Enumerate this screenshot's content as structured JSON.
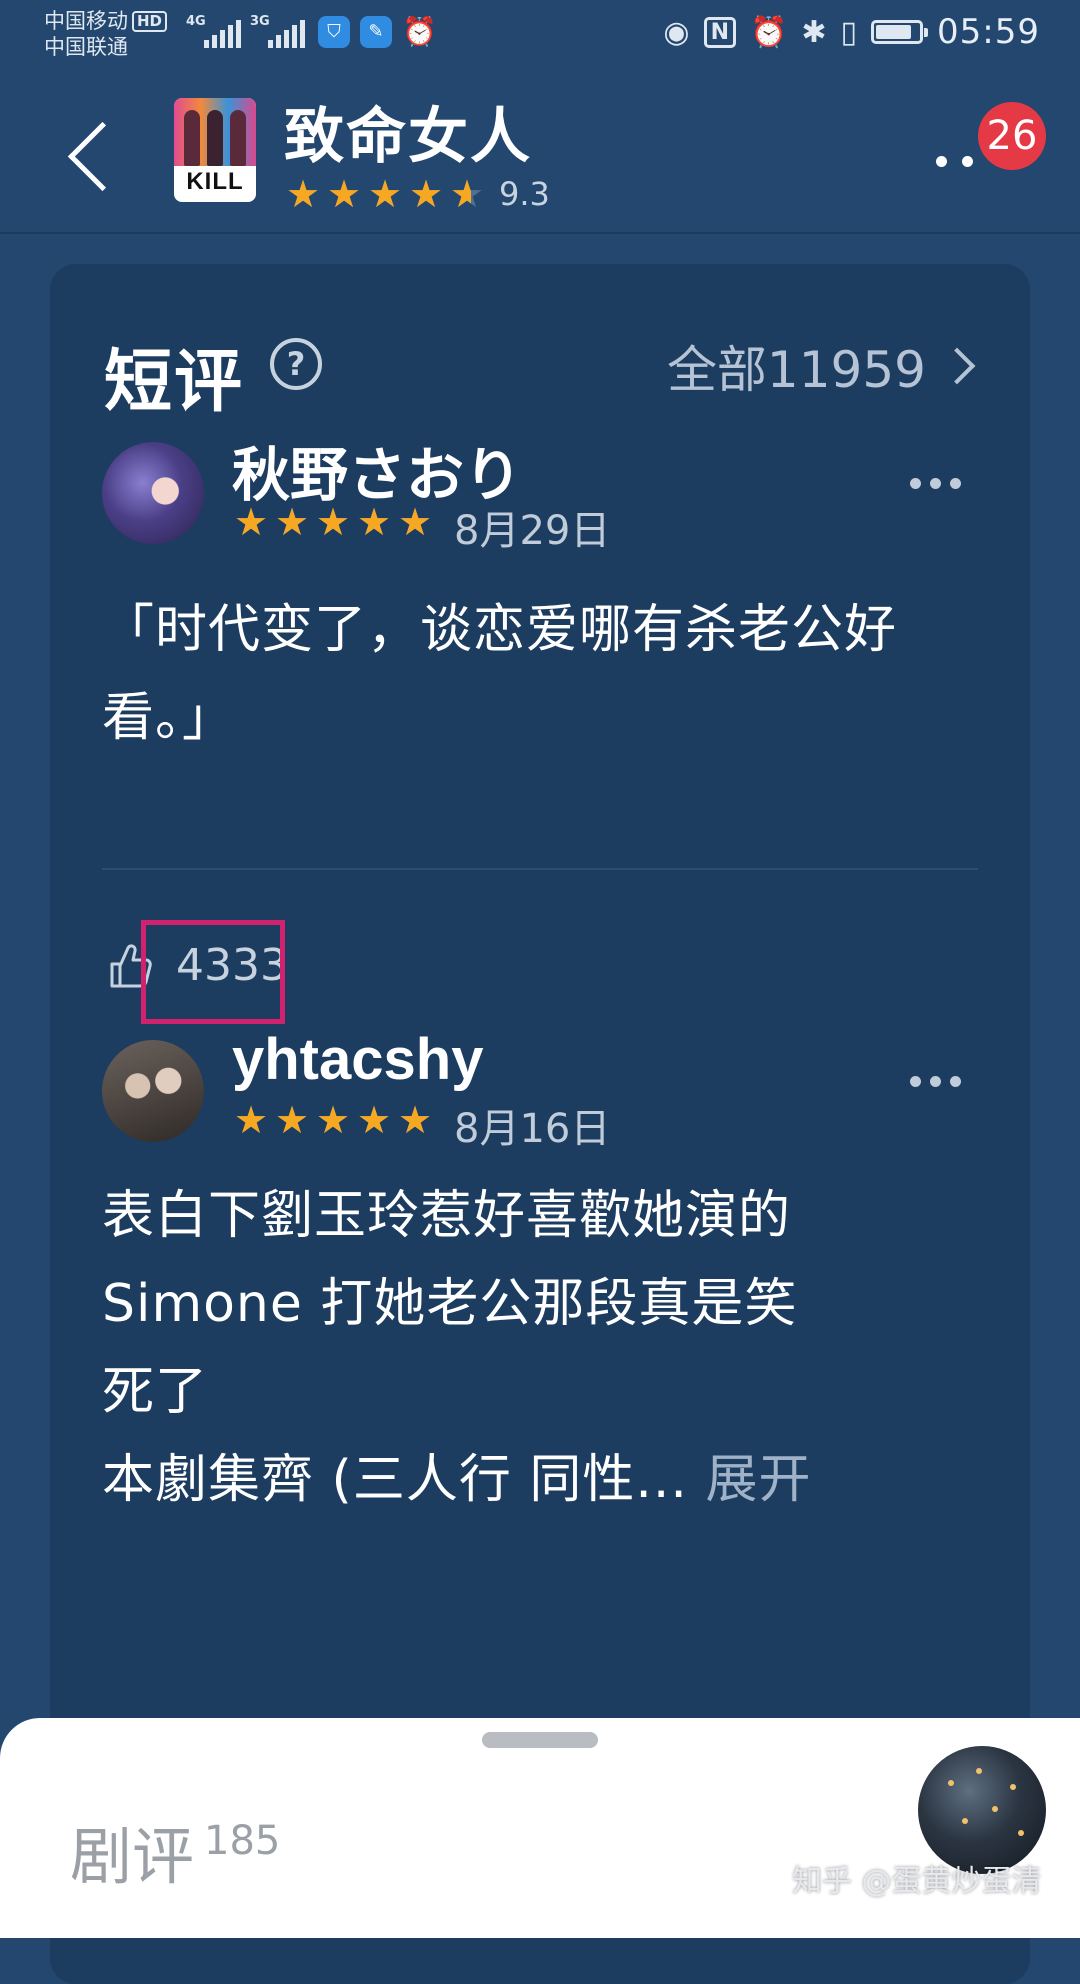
{
  "status_bar": {
    "carrier_1": "中国移动",
    "carrier_1_badge": "HD",
    "carrier_2": "中国联通",
    "signal_1_type": "4G",
    "signal_2_type": "3G",
    "nfc_label": "N",
    "battery_level": 0.85,
    "time": "05:59"
  },
  "header": {
    "title": "致命女人",
    "rating": "9.3",
    "rating_stars": 4.5,
    "poster_text": "KILL",
    "badge_count": "26"
  },
  "short_reviews": {
    "title": "短评",
    "help_icon": "?",
    "all_label": "全部11959"
  },
  "reviews": [
    {
      "username": "秋野さおり",
      "stars": 5,
      "date": "8月29日",
      "content": "「时代变了，谈恋爱哪有杀老公好看。」",
      "likes": "4333"
    },
    {
      "username": "yhtacshy",
      "stars": 5,
      "date": "8月16日",
      "content_lines": [
        "表白下劉玉玲惹好喜歡她演的",
        "Simone 打她老公那段真是笑",
        "死了",
        "本劇集齊 (三人行 同性..."
      ],
      "expand_label": "展开"
    }
  ],
  "bottom_sheet": {
    "tab_label": "剧评",
    "tab_count": "185"
  },
  "watermark": "知乎 @蛋黄炒蛋清",
  "colors": {
    "background": "#23476f",
    "card": "#1c3c60",
    "star": "#f7a823",
    "badge": "#e53a45",
    "highlight": "#d1226f"
  }
}
